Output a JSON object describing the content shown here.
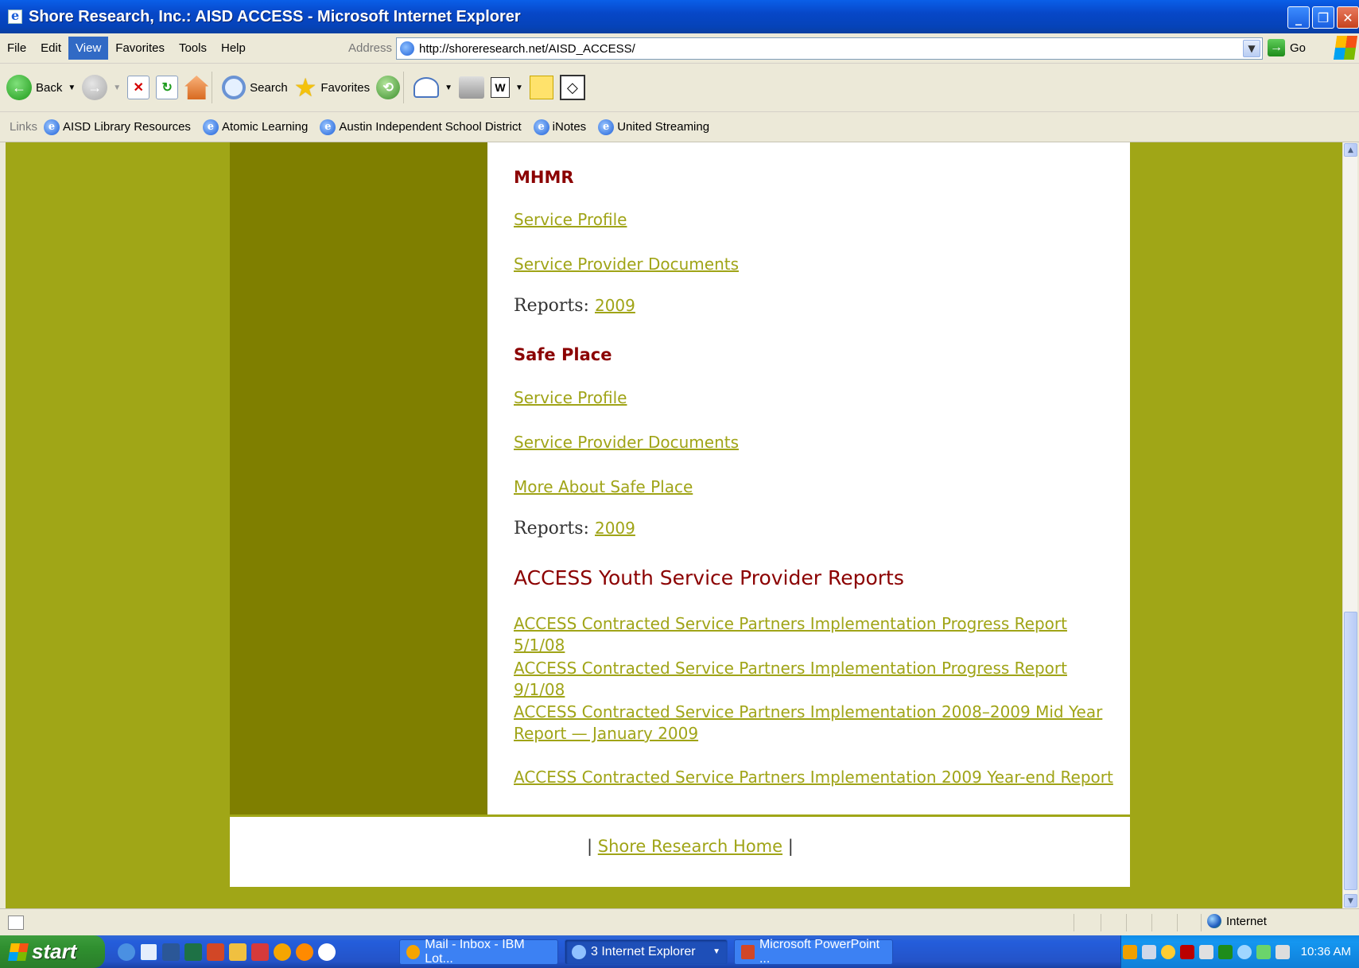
{
  "window": {
    "title": "Shore Research, Inc.: AISD ACCESS - Microsoft Internet Explorer",
    "minimize": "_",
    "restore": "❐",
    "close": "✕"
  },
  "menu": {
    "items": [
      "File",
      "Edit",
      "View",
      "Favorites",
      "Tools",
      "Help"
    ],
    "active": "View"
  },
  "address": {
    "label": "Address",
    "url": "http://shoreresearch.net/AISD_ACCESS/",
    "go_label": "Go"
  },
  "toolbar": {
    "back_label": "Back",
    "search_label": "Search",
    "favorites_label": "Favorites"
  },
  "links": {
    "label": "Links",
    "items": [
      "AISD Library Resources",
      "Atomic Learning",
      "Austin Independent School District",
      "iNotes",
      "United Streaming"
    ]
  },
  "page": {
    "mhmr": {
      "heading": "MHMR",
      "service_profile": "Service Profile",
      "provider_docs": "Service Provider Documents",
      "reports_label": "Reports:",
      "reports_year": "2009"
    },
    "safe_place": {
      "heading": "Safe Place",
      "service_profile": "Service Profile",
      "provider_docs": "Service Provider Documents",
      "more_about": "More About Safe Place",
      "reports_label": "Reports:",
      "reports_year": "2009"
    },
    "youth_reports": {
      "heading": "ACCESS Youth Service Provider Reports",
      "links": [
        "ACCESS Contracted Service Partners Implementation Progress Report 5/1/08",
        "ACCESS Contracted Service Partners Implementation Progress Report 9/1/08",
        "ACCESS Contracted Service Partners Implementation 2008–2009 Mid Year Report — January 2009",
        "ACCESS Contracted Service Partners Implementation 2009 Year-end Report"
      ]
    },
    "footer": {
      "left_bar": "|",
      "home_link": "Shore Research Home",
      "right_bar": "|"
    }
  },
  "status": {
    "zone": "Internet"
  },
  "taskbar": {
    "start_label": "start",
    "tasks": [
      "Mail - Inbox - IBM Lot...",
      "3 Internet Explorer",
      "Microsoft PowerPoint ..."
    ],
    "clock": "10:36 AM"
  },
  "colors": {
    "page_bg": "#A0A617",
    "sidebar": "#7F7F00",
    "heading": "#8B0000",
    "link": "#A0A417"
  }
}
